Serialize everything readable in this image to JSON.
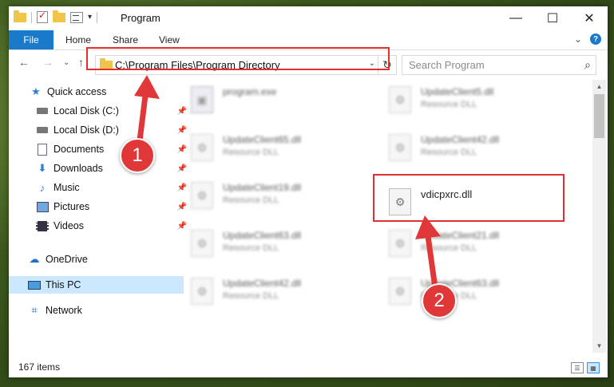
{
  "window": {
    "title": "Program",
    "minimize_glyph": "—",
    "maximize_glyph": "☐",
    "close_glyph": "✕"
  },
  "ribbon": {
    "tabs": [
      "File",
      "Home",
      "Share",
      "View"
    ],
    "expand_glyph": "⌄",
    "help_glyph": "?"
  },
  "nav": {
    "back_glyph": "←",
    "forward_glyph": "→",
    "recent_glyph": "⌄",
    "up_glyph": "↑",
    "address": "C:\\Program Files\\Program Directory",
    "refresh_glyph": "↻",
    "search_placeholder": "Search Program",
    "search_glyph": "⌕"
  },
  "sidebar": {
    "items": [
      {
        "label": "Quick access",
        "icon": "star-icon"
      },
      {
        "label": "Local Disk (C:)",
        "icon": "drive-icon",
        "pinned": true
      },
      {
        "label": "Local Disk (D:)",
        "icon": "drive-icon",
        "pinned": true
      },
      {
        "label": "Documents",
        "icon": "documents-icon",
        "pinned": true
      },
      {
        "label": "Downloads",
        "icon": "download-icon",
        "pinned": true
      },
      {
        "label": "Music",
        "icon": "music-icon",
        "pinned": true
      },
      {
        "label": "Pictures",
        "icon": "pictures-icon",
        "pinned": true
      },
      {
        "label": "Videos",
        "icon": "video-icon",
        "pinned": true
      },
      {
        "label": "OneDrive",
        "icon": "cloud-icon"
      },
      {
        "label": "This PC",
        "icon": "pc-icon",
        "selected": true
      },
      {
        "label": "Network",
        "icon": "network-icon"
      }
    ]
  },
  "files": [
    {
      "name": "program.exe",
      "type": ""
    },
    {
      "name": "UpdateClient5.dll",
      "type": "Resource DLL"
    },
    {
      "name": "UpdateClient65.dll",
      "type": "Resource DLL"
    },
    {
      "name": "UpdateClient42.dll",
      "type": "Resource DLL"
    },
    {
      "name": "UpdateClient19.dll",
      "type": "Resource DLL"
    },
    {
      "name": "vdicpxrc.dll",
      "type": ""
    },
    {
      "name": "UpdateClient63.dll",
      "type": "Resource DLL"
    },
    {
      "name": "UpdateClient21.dll",
      "type": "Resource DLL"
    },
    {
      "name": "UpdateClient42.dll",
      "type": "Resource DLL"
    },
    {
      "name": "UpdateClient63.dll",
      "type": "Resource DLL"
    }
  ],
  "status": {
    "item_count": "167 items"
  },
  "annotations": {
    "step1": "1",
    "step2": "2",
    "color": "#e03838"
  }
}
